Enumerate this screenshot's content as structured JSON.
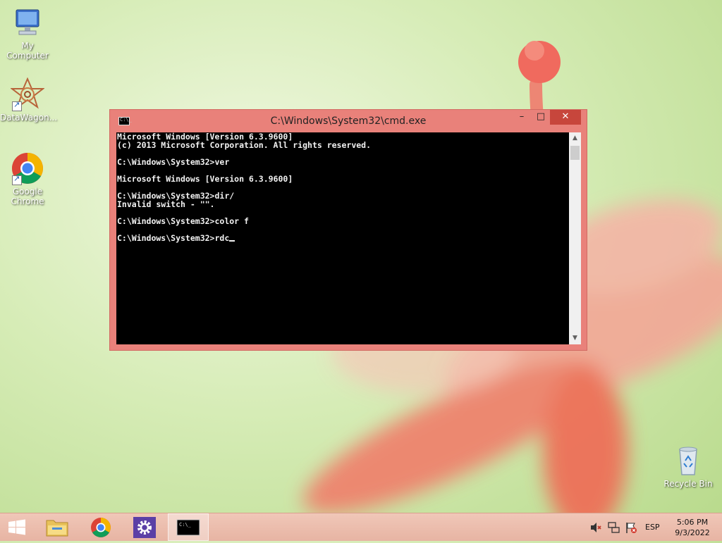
{
  "desktop": {
    "icons": [
      {
        "label": "My Computer"
      },
      {
        "label": "DataWagon..."
      },
      {
        "label": "Google Chrome"
      },
      {
        "label": "Recycle Bin"
      }
    ]
  },
  "window": {
    "title": "C:\\Windows\\System32\\cmd.exe",
    "title_icon_text": "C:\\_",
    "buttons": {
      "minimize": "–",
      "maximize": "□",
      "close": "✕"
    },
    "console_lines": [
      "Microsoft Windows [Version 6.3.9600]",
      "(c) 2013 Microsoft Corporation. All rights reserved.",
      "",
      "C:\\Windows\\System32>ver",
      "",
      "Microsoft Windows [Version 6.3.9600]",
      "",
      "C:\\Windows\\System32>dir/",
      "Invalid switch - \"\".",
      "",
      "C:\\Windows\\System32>color f",
      "",
      "C:\\Windows\\System32>rdc"
    ],
    "scrollbar": {
      "up": "▲",
      "down": "▼"
    }
  },
  "taskbar": {
    "tray": {
      "language": "ESP",
      "time": "5:06 PM",
      "date": "9/3/2022"
    }
  },
  "colors": {
    "window_frame": "#e9817a",
    "close_button": "#c7463c",
    "console_bg": "#000000",
    "console_text": "#f2f2f2",
    "taskbar": "#ebbcab"
  }
}
